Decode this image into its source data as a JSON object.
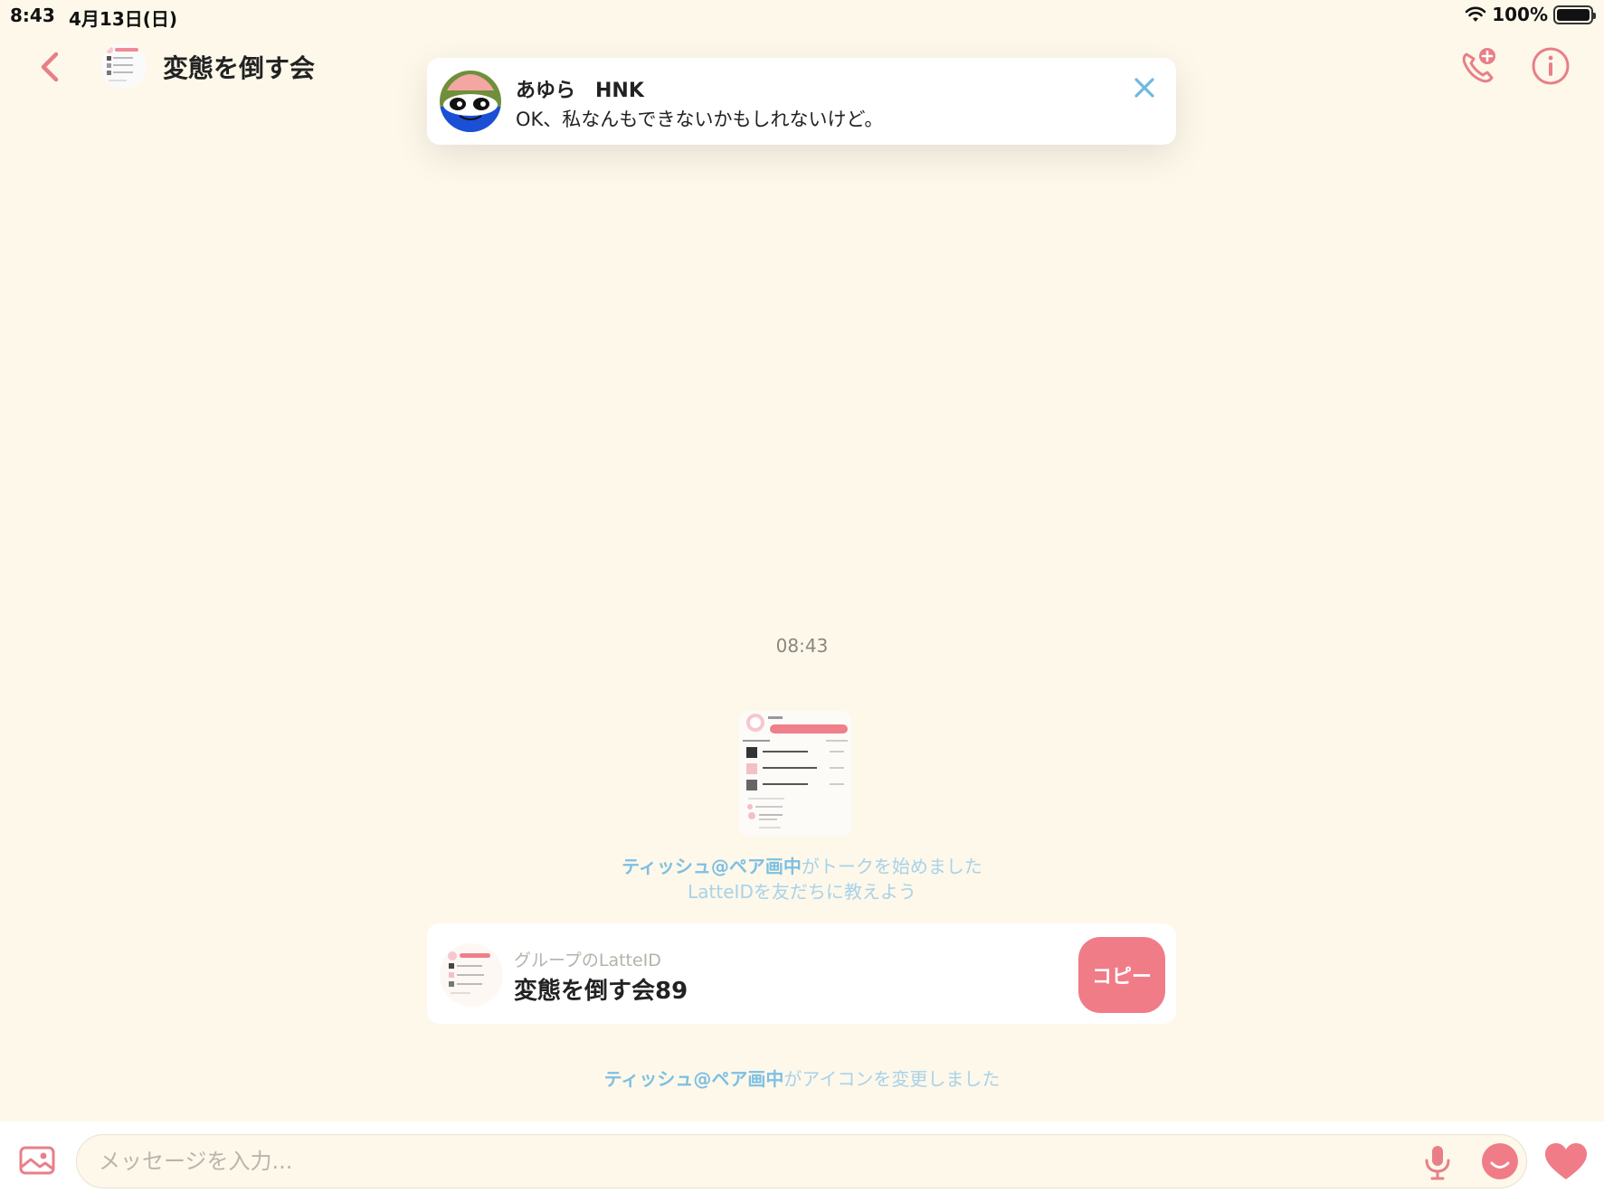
{
  "status_bar": {
    "time": "8:43",
    "date": "4月13日(日)",
    "battery": "100%"
  },
  "header": {
    "title": "変態を倒す会"
  },
  "notification": {
    "sender": "あゆら　HNK",
    "message": "OK、私なんもできないかもしれないけど。"
  },
  "chat": {
    "timestamp": "08:43",
    "system_messages": [
      {
        "name": "ティッシュ@ペア画中",
        "text": "がトークを始めました"
      },
      {
        "subtext": "LatteIDを友だちに教えよう"
      },
      {
        "name": "ティッシュ@ペア画中",
        "text": "がアイコンを変更しました"
      }
    ],
    "id_card": {
      "label": "グループのLatteID",
      "value": "変態を倒す会89",
      "button": "コピー"
    }
  },
  "input": {
    "placeholder": "メッセージを入力..."
  },
  "colors": {
    "accent_pink": "#f07c87",
    "link_blue": "#7ec0e2",
    "background": "#fdf8ea"
  }
}
